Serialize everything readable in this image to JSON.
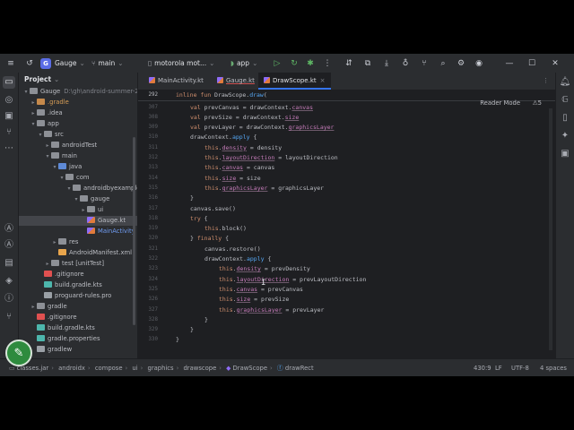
{
  "titlebar": {
    "project_initial": "G",
    "project_name": "Gauge",
    "branch": "main",
    "device": "motorola mot...",
    "run_config": "app"
  },
  "project_panel": {
    "title": "Project",
    "tree": [
      {
        "label": "Gauge",
        "suffix": "D:\\gh\\android-summer-202",
        "indent": 0,
        "arrow": "▾",
        "icon": "folder"
      },
      {
        "label": ".gradle",
        "indent": 1,
        "arrow": "▸",
        "icon": "folder-ex",
        "color": "orange"
      },
      {
        "label": ".idea",
        "indent": 1,
        "arrow": "▸",
        "icon": "folder"
      },
      {
        "label": "app",
        "indent": 1,
        "arrow": "▾",
        "icon": "folder"
      },
      {
        "label": "src",
        "indent": 2,
        "arrow": "▾",
        "icon": "folder"
      },
      {
        "label": "androidTest",
        "indent": 3,
        "arrow": "▸",
        "icon": "folder"
      },
      {
        "label": "main",
        "indent": 3,
        "arrow": "▾",
        "icon": "folder"
      },
      {
        "label": "java",
        "indent": 4,
        "arrow": "▾",
        "icon": "folder-src"
      },
      {
        "label": "com",
        "indent": 5,
        "arrow": "▾",
        "icon": "folder"
      },
      {
        "label": "androidbyexample",
        "indent": 6,
        "arrow": "▾",
        "icon": "folder"
      },
      {
        "label": "gauge",
        "indent": 7,
        "arrow": "▾",
        "icon": "folder"
      },
      {
        "label": "ui",
        "indent": 8,
        "arrow": "▸",
        "icon": "folder"
      },
      {
        "label": "Gauge.kt",
        "indent": 8,
        "arrow": "",
        "icon": "kt",
        "selected": true
      },
      {
        "label": "MainActivity",
        "indent": 8,
        "arrow": "",
        "icon": "kt",
        "color": "link"
      },
      {
        "label": "res",
        "indent": 4,
        "arrow": "▸",
        "icon": "folder"
      },
      {
        "label": "AndroidManifest.xml",
        "indent": 4,
        "arrow": "",
        "icon": "xml"
      },
      {
        "label": "test [unitTest]",
        "indent": 3,
        "arrow": "▸",
        "icon": "folder"
      },
      {
        "label": ".gitignore",
        "indent": 2,
        "arrow": "",
        "icon": "gi"
      },
      {
        "label": "build.gradle.kts",
        "indent": 2,
        "arrow": "",
        "icon": "gradle"
      },
      {
        "label": "proguard-rules.pro",
        "indent": 2,
        "arrow": "",
        "icon": "txt"
      },
      {
        "label": "gradle",
        "indent": 1,
        "arrow": "▸",
        "icon": "folder"
      },
      {
        "label": ".gitignore",
        "indent": 1,
        "arrow": "",
        "icon": "gi"
      },
      {
        "label": "build.gradle.kts",
        "indent": 1,
        "arrow": "",
        "icon": "gradle"
      },
      {
        "label": "gradle.properties",
        "indent": 1,
        "arrow": "",
        "icon": "gradle"
      },
      {
        "label": "gradlew",
        "indent": 1,
        "arrow": "",
        "icon": "txt"
      }
    ]
  },
  "tabs": [
    {
      "label": "MainActivity.kt",
      "active": false
    },
    {
      "label": "Gauge.kt",
      "active": false,
      "link": true
    },
    {
      "label": "DrawScope.kt",
      "active": true
    }
  ],
  "editor": {
    "reader_mode": "Reader Mode",
    "warnings": "⚠5",
    "sticky_line": "292",
    "sticky_code": "inline fun DrawScope.draw(",
    "lines": [
      {
        "n": "307",
        "indent": 1,
        "html": "<span class='kw'>val</span> prevCanvas = drawContext.<span class='pr'>canvas</span>"
      },
      {
        "n": "308",
        "indent": 1,
        "html": "<span class='kw'>val</span> prevSize = drawContext.<span class='pr'>size</span>"
      },
      {
        "n": "309",
        "indent": 1,
        "html": "<span class='kw'>val</span> prevLayer = drawContext.<span class='pr'>graphicsLayer</span>"
      },
      {
        "n": "310",
        "indent": 1,
        "html": "drawContext.<span class='fn'>apply</span> {"
      },
      {
        "n": "311",
        "indent": 2,
        "html": "<span class='kw'>this</span>.<span class='pr'>density</span> = density"
      },
      {
        "n": "312",
        "indent": 2,
        "html": "<span class='kw'>this</span>.<span class='pr'>layoutDirection</span> = layoutDirection"
      },
      {
        "n": "313",
        "indent": 2,
        "html": "<span class='kw'>this</span>.<span class='pr'>canvas</span> = canvas"
      },
      {
        "n": "314",
        "indent": 2,
        "html": "<span class='kw'>this</span>.<span class='pr'>size</span> = size"
      },
      {
        "n": "315",
        "indent": 2,
        "html": "<span class='kw'>this</span>.<span class='pr'>graphicsLayer</span> = graphicsLayer"
      },
      {
        "n": "316",
        "indent": 1,
        "html": "}"
      },
      {
        "n": "317",
        "indent": 1,
        "html": "canvas.save()"
      },
      {
        "n": "318",
        "indent": 1,
        "html": "<span class='kw'>try</span> {"
      },
      {
        "n": "319",
        "indent": 2,
        "html": "<span class='kw'>this</span>.block()"
      },
      {
        "n": "320",
        "indent": 1,
        "html": "} <span class='kw'>finally</span> {"
      },
      {
        "n": "321",
        "indent": 2,
        "html": "canvas.restore()"
      },
      {
        "n": "322",
        "indent": 2,
        "html": "drawContext.<span class='fn'>apply</span> {"
      },
      {
        "n": "323",
        "indent": 3,
        "html": "<span class='kw'>this</span>.<span class='pr'>density</span> = prevDensity"
      },
      {
        "n": "324",
        "indent": 3,
        "html": "<span class='kw'>this</span>.<span class='pr'>layoutDirection</span> = prevLayoutDirection"
      },
      {
        "n": "325",
        "indent": 3,
        "html": "<span class='kw'>this</span>.<span class='pr'>canvas</span> = prevCanvas"
      },
      {
        "n": "326",
        "indent": 3,
        "html": "<span class='kw'>this</span>.<span class='pr'>size</span> = prevSize"
      },
      {
        "n": "327",
        "indent": 3,
        "html": "<span class='kw'>this</span>.<span class='pr'>graphicsLayer</span> = prevLayer"
      },
      {
        "n": "328",
        "indent": 2,
        "html": "}"
      },
      {
        "n": "329",
        "indent": 1,
        "html": "}"
      },
      {
        "n": "330",
        "indent": 0,
        "html": "}"
      }
    ]
  },
  "statusbar": {
    "breadcrumb": [
      "classes.jar",
      "androidx",
      "compose",
      "ui",
      "graphics",
      "drawscope",
      "DrawScope",
      "drawRect"
    ],
    "position": "430:9",
    "line_sep": "LF",
    "encoding": "UTF-8",
    "indent": "4 spaces"
  },
  "colors": {
    "accent": "#3574f0",
    "fab": "#2e8b3e",
    "keyword": "#cf8e6d",
    "property": "#c77dbb"
  }
}
